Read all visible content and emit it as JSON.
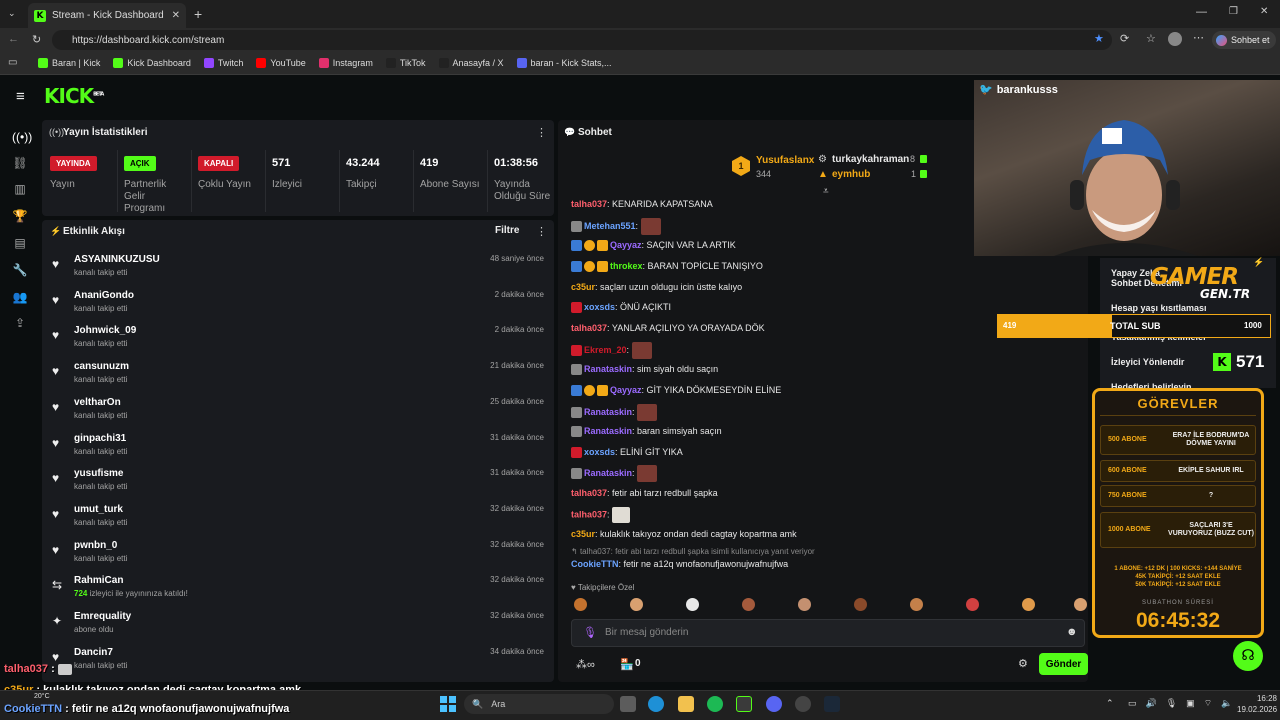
{
  "browser": {
    "tab_title": "Stream - Kick Dashboard",
    "url": "https://dashboard.kick.com/stream",
    "copilot_label": "Sohbet et",
    "bookmarks": [
      {
        "label": "Baran | Kick",
        "color": "#53fc18"
      },
      {
        "label": "Kick Dashboard",
        "color": "#53fc18"
      },
      {
        "label": "Twitch",
        "color": "#9146ff"
      },
      {
        "label": "YouTube",
        "color": "#ff0000"
      },
      {
        "label": "Instagram",
        "color": "#e1306c"
      },
      {
        "label": "TikTok",
        "color": "#222222"
      },
      {
        "label": "Anasayfa / X",
        "color": "#222222"
      },
      {
        "label": "baran - Kick Stats,...",
        "color": "#5865f2"
      }
    ]
  },
  "logo": {
    "text": "KICK",
    "beta": "BETA"
  },
  "stats": {
    "title": "Yayın İstatistikleri",
    "items": [
      {
        "badge": "YAYINDA",
        "badge_color": "#d11b2b",
        "label": "Yayın"
      },
      {
        "badge": "AÇIK",
        "badge_color": "#53fc18",
        "label": "Partnerlik Gelir Programı"
      },
      {
        "badge": "KAPALI",
        "badge_color": "#d11b2b",
        "label": "Çoklu Yayın"
      },
      {
        "value": "571",
        "label": "İzleyici"
      },
      {
        "value": "43.244",
        "label": "Takipçi"
      },
      {
        "value": "419",
        "label": "Abone Sayısı"
      },
      {
        "value": "01:38:56",
        "label": "Yayında Olduğu Süre"
      }
    ]
  },
  "activity": {
    "title": "Etkinlik Akışı",
    "filter": "Filtre",
    "items": [
      {
        "name": "ASYANINKUZUSU",
        "sub": "kanalı takip etti",
        "time": "48 saniye önce",
        "icon": "♥"
      },
      {
        "name": "AnaniGondo",
        "sub": "kanalı takip etti",
        "time": "2 dakika önce",
        "icon": "♥"
      },
      {
        "name": "Johnwick_09",
        "sub": "kanalı takip etti",
        "time": "2 dakika önce",
        "icon": "♥"
      },
      {
        "name": "cansunuzm",
        "sub": "kanalı takip etti",
        "time": "21 dakika önce",
        "icon": "♥"
      },
      {
        "name": "veltharOn",
        "sub": "kanalı takip etti",
        "time": "25 dakika önce",
        "icon": "♥"
      },
      {
        "name": "ginpachi31",
        "sub": "kanalı takip etti",
        "time": "31 dakika önce",
        "icon": "♥"
      },
      {
        "name": "yusufisme",
        "sub": "kanalı takip etti",
        "time": "31 dakika önce",
        "icon": "♥"
      },
      {
        "name": "umut_turk",
        "sub": "kanalı takip etti",
        "time": "32 dakika önce",
        "icon": "♥"
      },
      {
        "name": "pwnbn_0",
        "sub": "kanalı takip etti",
        "time": "32 dakika önce",
        "icon": "♥"
      },
      {
        "name": "RahmiCan",
        "sub_count": "724",
        "sub": " izleyici ile yayınınıza katıldı!",
        "time": "32 dakika önce",
        "icon": "⇆"
      },
      {
        "name": "Emrequality",
        "sub": "abone oldu",
        "time": "32 dakika önce",
        "icon": "✦"
      },
      {
        "name": "Dancin7",
        "sub": "kanalı takip etti",
        "time": "34 dakika önce",
        "icon": "♥"
      }
    ]
  },
  "chat": {
    "title": "Sohbet",
    "leaderboard": [
      {
        "name": "Yusufaslanx",
        "value": "344",
        "rank": "1",
        "color": "#f2a917"
      },
      {
        "name": "turkaykahraman",
        "value": "8",
        "color": "#e8e8e8"
      },
      {
        "name": "eymhub",
        "value": "1",
        "color": "#f2a917"
      }
    ],
    "messages": [
      {
        "user": "talha037",
        "color": "#ff5f6d",
        "text": "KENARIDA KAPATSANA"
      },
      {
        "user": "Metehan551",
        "color": "#6ba3ff",
        "text": "",
        "emote": true
      },
      {
        "user": "Qayyaz",
        "color": "#9b6bff",
        "text": "SAÇIN VAR LA ARTIK",
        "badges": true
      },
      {
        "user": "throkex",
        "color": "#53fc18",
        "text": "BARAN TOPİCLE TANIŞIYO",
        "badges": true
      },
      {
        "user": "c35ur",
        "color": "#f2a917",
        "text": "saçları uzun oldugu icin üstte kalıyo"
      },
      {
        "user": "xoxsds",
        "color": "#6ba3ff",
        "text": "ÖNÜ AÇIKTI"
      },
      {
        "user": "talha037",
        "color": "#ff5f6d",
        "text": "YANLAR AÇILIYO YA ORAYADA DÖK"
      },
      {
        "user": "Ekrem_20",
        "color": "#d11b2b",
        "text": "",
        "emote": true
      },
      {
        "user": "Ranataskin",
        "color": "#9b6bff",
        "text": "sim siyah oldu saçın"
      },
      {
        "user": "Qayyaz",
        "color": "#9b6bff",
        "text": "GİT YIKA DÖKMESEYDİN ELİNE",
        "badges": true
      },
      {
        "user": "Ranataskin",
        "color": "#9b6bff",
        "text": "",
        "emote": true
      },
      {
        "user": "Ranataskin",
        "color": "#9b6bff",
        "text": "baran simsiyah saçın"
      },
      {
        "user": "xoxsds",
        "color": "#6ba3ff",
        "text": "ELİNİ GİT YIKA"
      },
      {
        "user": "Ranataskin",
        "color": "#9b6bff",
        "text": "",
        "emote": true
      },
      {
        "user": "talha037",
        "color": "#ff5f6d",
        "text": "fetir abi tarzı redbull şapka"
      },
      {
        "user": "talha037",
        "color": "#ff5f6d",
        "text": "",
        "emote": true
      },
      {
        "user": "c35ur",
        "color": "#f2a917",
        "text": "kulaklık takıyoz ondan dedi cagtay kopartma amk"
      }
    ],
    "reply_context": "talha037: fetir abi tarzı redbull şapka isimli kullanıcıya yanıt veriyor",
    "reply": {
      "user": "CookieTTN",
      "color": "#6ba3ff",
      "text": "fetir ne a12q wnofaonufjawonujwafnujfwa"
    },
    "followers_only": "Takipçilere Özel",
    "input_placeholder": "Bir mesaj gönderin",
    "points": "0",
    "send_label": "Gönder"
  },
  "overlay": {
    "streamer": "barankusss",
    "menu": [
      "Yapay Zeka",
      "Sohbet Denetimi",
      "Hesap yaşı kısıtlaması",
      "Yasaklanmış kelimeler",
      "İzleyici Yönlendir",
      "Hedefleri belirleyin"
    ],
    "brand_top": "GAMER",
    "brand_bottom": "GEN.TR",
    "sub_goal": {
      "label": "TOTAL SUB",
      "current": "419",
      "target": "1000",
      "progress": 0.419
    },
    "viewer_count": "571",
    "gorevler_title": "GÖREVLER",
    "gorevler": [
      {
        "goal": "500 ABONE",
        "reward": "ERA7 İLE BODRUM'DA DÖVME YAYINI"
      },
      {
        "goal": "600 ABONE",
        "reward": "EKİPLE SAHUR IRL"
      },
      {
        "goal": "750 ABONE",
        "reward": "?"
      },
      {
        "goal": "1000 ABONE",
        "reward": "SAÇLARI 3'E VURUYORUZ (BUZZ CUT)"
      }
    ],
    "rates": [
      "1 ABONE: +12 DK | 100 KICKS: +144 SANİYE",
      "45K TAKİPÇİ: +12 SAAT EKLE",
      "50K TAKİPÇİ: +12 SAAT EKLE"
    ],
    "subathon_label": "SUBATHON SÜRESİ",
    "subathon_time": "06:45:32"
  },
  "stream_chat_overlay": [
    {
      "user": "talha037",
      "color": "#ff5f6d",
      "text": " : "
    },
    {
      "user": "c35ur",
      "color": "#f2a917",
      "text": " : kulaklık takıyoz ondan dedi cagtay kopartma amk"
    },
    {
      "user": "CookieTTN",
      "color": "#6ba3ff",
      "text": " : fetir ne a12q wnofaonufjawonujwafnujfwa"
    }
  ],
  "taskbar": {
    "search": "Ara",
    "weather": "20°C",
    "time": "16:28",
    "date": "19.02.2026"
  }
}
